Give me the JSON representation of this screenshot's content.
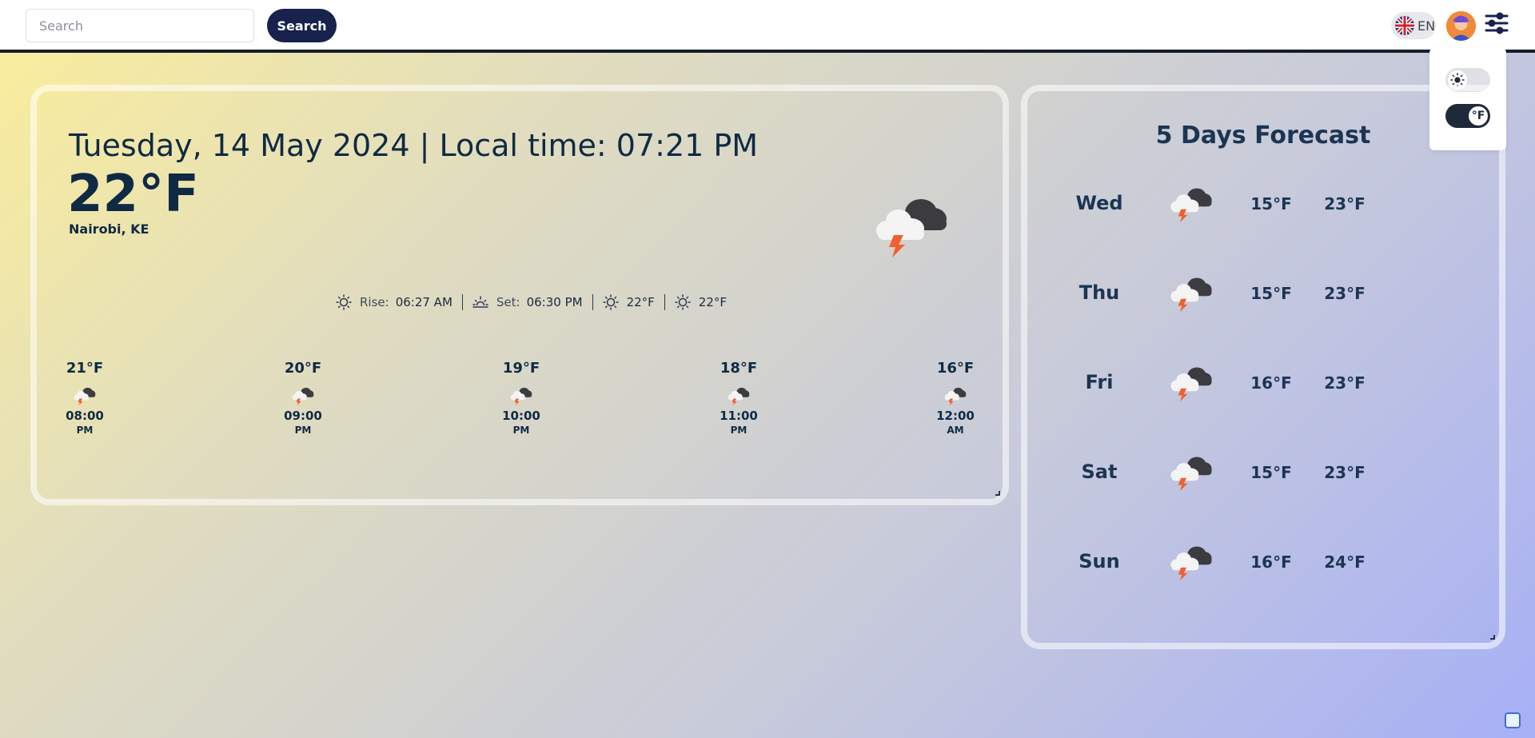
{
  "header": {
    "search_placeholder": "Search",
    "search_button": "Search",
    "language": "EN"
  },
  "settings": {
    "theme_toggle_state": "light",
    "unit_toggle_label": "°F"
  },
  "current": {
    "date_line": "Tuesday, 14 May 2024 | Local time: 07:21 PM",
    "temperature": "22°F",
    "location": "Nairobi, KE",
    "rise_label": "Rise:",
    "rise_time": "06:27 AM",
    "set_label": "Set:",
    "set_time": "06:30 PM",
    "high": "22°F",
    "low": "22°F"
  },
  "hourly": [
    {
      "temp": "21°F",
      "time": "08:00",
      "ampm": "PM"
    },
    {
      "temp": "20°F",
      "time": "09:00",
      "ampm": "PM"
    },
    {
      "temp": "19°F",
      "time": "10:00",
      "ampm": "PM"
    },
    {
      "temp": "18°F",
      "time": "11:00",
      "ampm": "PM"
    },
    {
      "temp": "16°F",
      "time": "12:00",
      "ampm": "AM"
    }
  ],
  "forecast": {
    "title": "5 Days Forecast",
    "days": [
      {
        "day": "Wed",
        "low": "15°F",
        "high": "23°F"
      },
      {
        "day": "Thu",
        "low": "15°F",
        "high": "23°F"
      },
      {
        "day": "Fri",
        "low": "16°F",
        "high": "23°F"
      },
      {
        "day": "Sat",
        "low": "15°F",
        "high": "23°F"
      },
      {
        "day": "Sun",
        "low": "16°F",
        "high": "24°F"
      }
    ]
  },
  "icons": {
    "weather": "thunderstorm-cloud-icon",
    "accent": "#17224d",
    "bolt_color": "#f0602c"
  }
}
